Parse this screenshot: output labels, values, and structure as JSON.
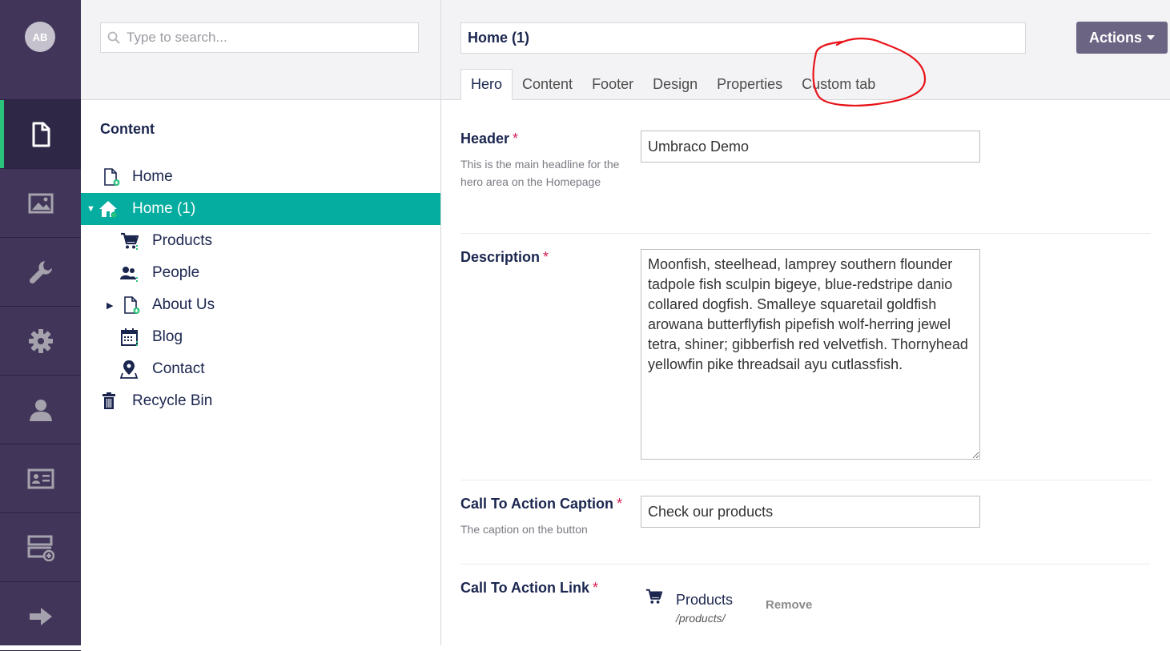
{
  "user": {
    "initials": "AB"
  },
  "sections": [
    {
      "icon": "document-icon",
      "active": true
    },
    {
      "icon": "media-icon"
    },
    {
      "icon": "wrench-icon"
    },
    {
      "icon": "gear-icon"
    },
    {
      "icon": "user-icon"
    },
    {
      "icon": "id-card-icon"
    },
    {
      "icon": "form-add-icon"
    },
    {
      "icon": "arrow-right-icon"
    }
  ],
  "tree": {
    "search_placeholder": "Type to search...",
    "title": "Content",
    "nodes": [
      {
        "label": "Home",
        "icon": "document-add-icon"
      },
      {
        "label": "Home (1)",
        "icon": "home-icon",
        "selected": true,
        "expanded": true
      },
      {
        "label": "Products",
        "icon": "cart-icon"
      },
      {
        "label": "People",
        "icon": "people-icon"
      },
      {
        "label": "About Us",
        "icon": "document-add-icon",
        "collapsed": true
      },
      {
        "label": "Blog",
        "icon": "calendar-icon"
      },
      {
        "label": "Contact",
        "icon": "map-pin-icon"
      },
      {
        "label": "Recycle Bin",
        "icon": "trash-icon"
      }
    ]
  },
  "editor": {
    "name": "Home (1)",
    "actions_label": "Actions",
    "tabs": [
      "Hero",
      "Content",
      "Footer",
      "Design",
      "Properties",
      "Custom tab"
    ],
    "active_tab": "Hero",
    "annotation_color": "#e8141a",
    "properties": {
      "header": {
        "label": "Header",
        "required": "*",
        "description": "This is the main headline for the hero area on the Homepage",
        "value": "Umbraco Demo"
      },
      "description": {
        "label": "Description",
        "required": "*",
        "value": "Moonfish, steelhead, lamprey southern flounder tadpole fish sculpin bigeye, blue-redstripe danio collared dogfish. Smalleye squaretail goldfish arowana butterflyfish pipefish wolf-herring jewel tetra, shiner; gibberfish red velvetfish. Thornyhead yellowfin pike threadsail ayu cutlassfish."
      },
      "cta_caption": {
        "label": "Call To Action Caption",
        "required": "*",
        "description": "The caption on the button",
        "value": "Check our products"
      },
      "cta_link": {
        "label": "Call To Action Link",
        "required": "*",
        "link_name": "Products",
        "link_url": "/products/",
        "remove_label": "Remove"
      }
    }
  },
  "colors": {
    "appbar": "#413659",
    "selected": "#04ad9f",
    "active_marker": "#2bc37c",
    "required": "#d42054"
  }
}
